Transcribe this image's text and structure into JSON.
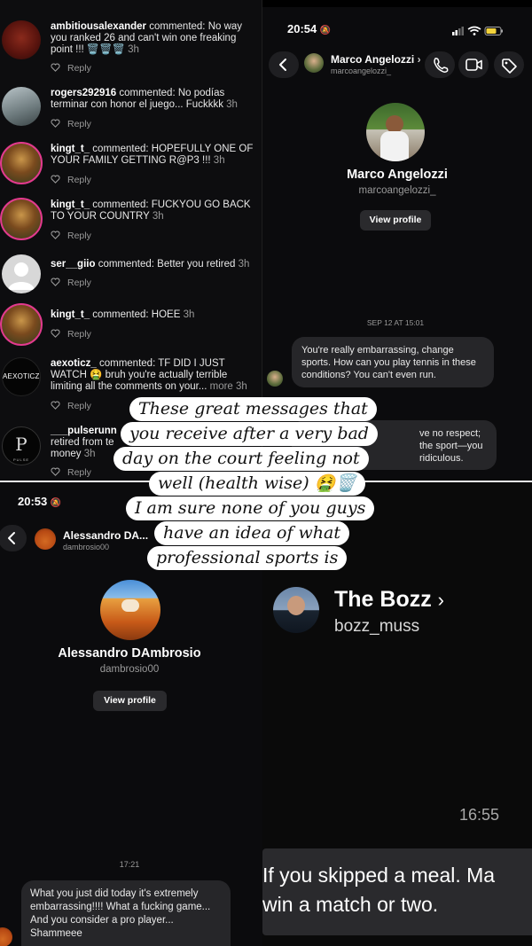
{
  "comments": [
    {
      "user": "ambitiousalexander",
      "text": "commented: No way you ranked 26 and can't win one freaking point !!! 🗑️🗑️🗑️",
      "time": "3h",
      "reply": "Reply"
    },
    {
      "user": "rogers292916",
      "text": "commented: No podías terminar con honor el juego... Fuckkkk",
      "time": "3h",
      "reply": "Reply"
    },
    {
      "user": "kingt_t_",
      "text": "commented: HOPEFULLY ONE OF YOUR FAMILY GETTING R@P3 !!!",
      "time": "3h",
      "reply": "Reply"
    },
    {
      "user": "kingt_t_",
      "text": "commented: FUCKYOU GO BACK TO YOUR COUNTRY",
      "time": "3h",
      "reply": "Reply"
    },
    {
      "user": "ser__giio",
      "text": "commented: Better you retired",
      "time": "3h",
      "reply": "Reply"
    },
    {
      "user": "kingt_t_",
      "text": "commented: HOEE",
      "time": "3h",
      "reply": "Reply"
    },
    {
      "user": "aexoticz_",
      "text": "commented: TF DID I JUST WATCH 🤮 bruh you're actually terrible limiting all the comments on your...",
      "more": "more",
      "time": "3h",
      "reply": "Reply"
    },
    {
      "user": "___pulserunn",
      "text": "retired from te",
      "line3": "money",
      "time": "3h",
      "reply": "Reply"
    }
  ],
  "avatar_labels": {
    "aexoticz": "AEXOTICZ_",
    "pulse": "PULSE"
  },
  "dm_top": {
    "time": "20:54",
    "name": "Marco Angelozzi",
    "handle": "marcoangelozzi_",
    "profile_name": "Marco Angelozzi",
    "profile_handle": "marcoangelozzi_",
    "view_profile": "View profile",
    "timestamp": "SEP 12 AT 15:01",
    "message1": "You're really embarrassing, change sports. How can you play tennis in these conditions? You can't even run.",
    "message2_line1": "ve no respect;",
    "message2_line2": "the sport—you",
    "message2_line3": "ridiculous."
  },
  "dm_bottom": {
    "time": "20:53",
    "name": "Alessandro DA...",
    "handle": "dambrosio00",
    "profile_name": "Alessandro DAmbrosio",
    "profile_handle": "dambrosio00",
    "view_profile": "View profile",
    "timestamp": "17:21",
    "message": "What you just did today it's extremely embarrassing!!!! What a fucking game... And you consider a pro player... Shammeee"
  },
  "bozz": {
    "name": "The Bozz",
    "handle": "bozz_muss",
    "time": "16:55",
    "msg_line1": "If you skipped a meal. Ma",
    "msg_line2": "win a match or two."
  },
  "overlay": [
    "These great messages that",
    "you receive after a very bad",
    "day on the court feeling not",
    "well (health wise) 🤮🗑️",
    "I am sure none of you guys",
    "have an idea of what",
    "professional sports is"
  ]
}
